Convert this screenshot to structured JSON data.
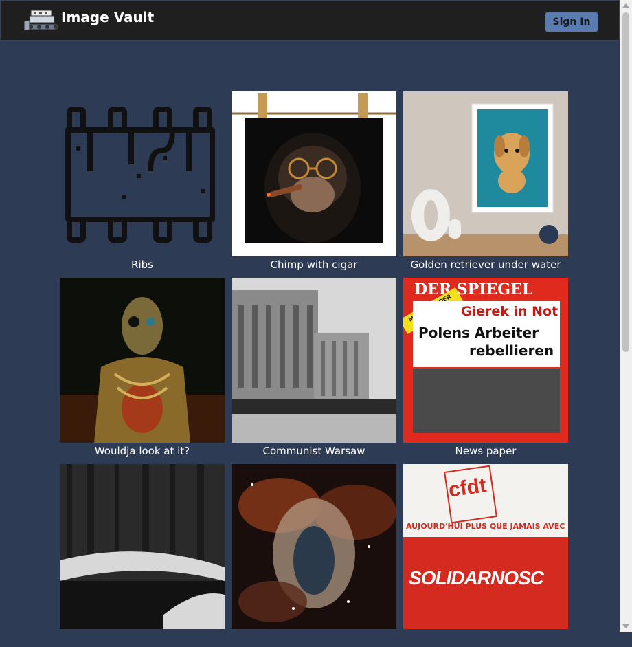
{
  "header": {
    "brand": "Image Vault",
    "sign_in_label": "Sign In",
    "logo_icon": "server-bulldozer-icon"
  },
  "gallery": {
    "items": [
      {
        "caption": "Ribs"
      },
      {
        "caption": "Chimp with cigar"
      },
      {
        "caption": "Golden retriever under water"
      },
      {
        "caption": "Wouldja look at it?"
      },
      {
        "caption": "Communist Warsaw"
      },
      {
        "caption": "News paper",
        "headline_1": "DER SPIEGEL",
        "headline_2": "Gierek in Not",
        "headline_3": "Polens Arbeiter",
        "headline_4": "rebellieren",
        "banner": "MEDIZIN IN DER KRISE"
      },
      {
        "caption": ""
      },
      {
        "caption": ""
      },
      {
        "caption": "",
        "poster_top": "cfdt",
        "poster_mid": "AUJOURD'HUI PLUS QUE JAMAIS AVEC",
        "poster_main": "SOLIDARNOSC"
      }
    ]
  },
  "colors": {
    "background": "#2e3b55",
    "header": "#1f1f1f",
    "button": "#5a7bb0",
    "accent_red": "#d42a20"
  }
}
